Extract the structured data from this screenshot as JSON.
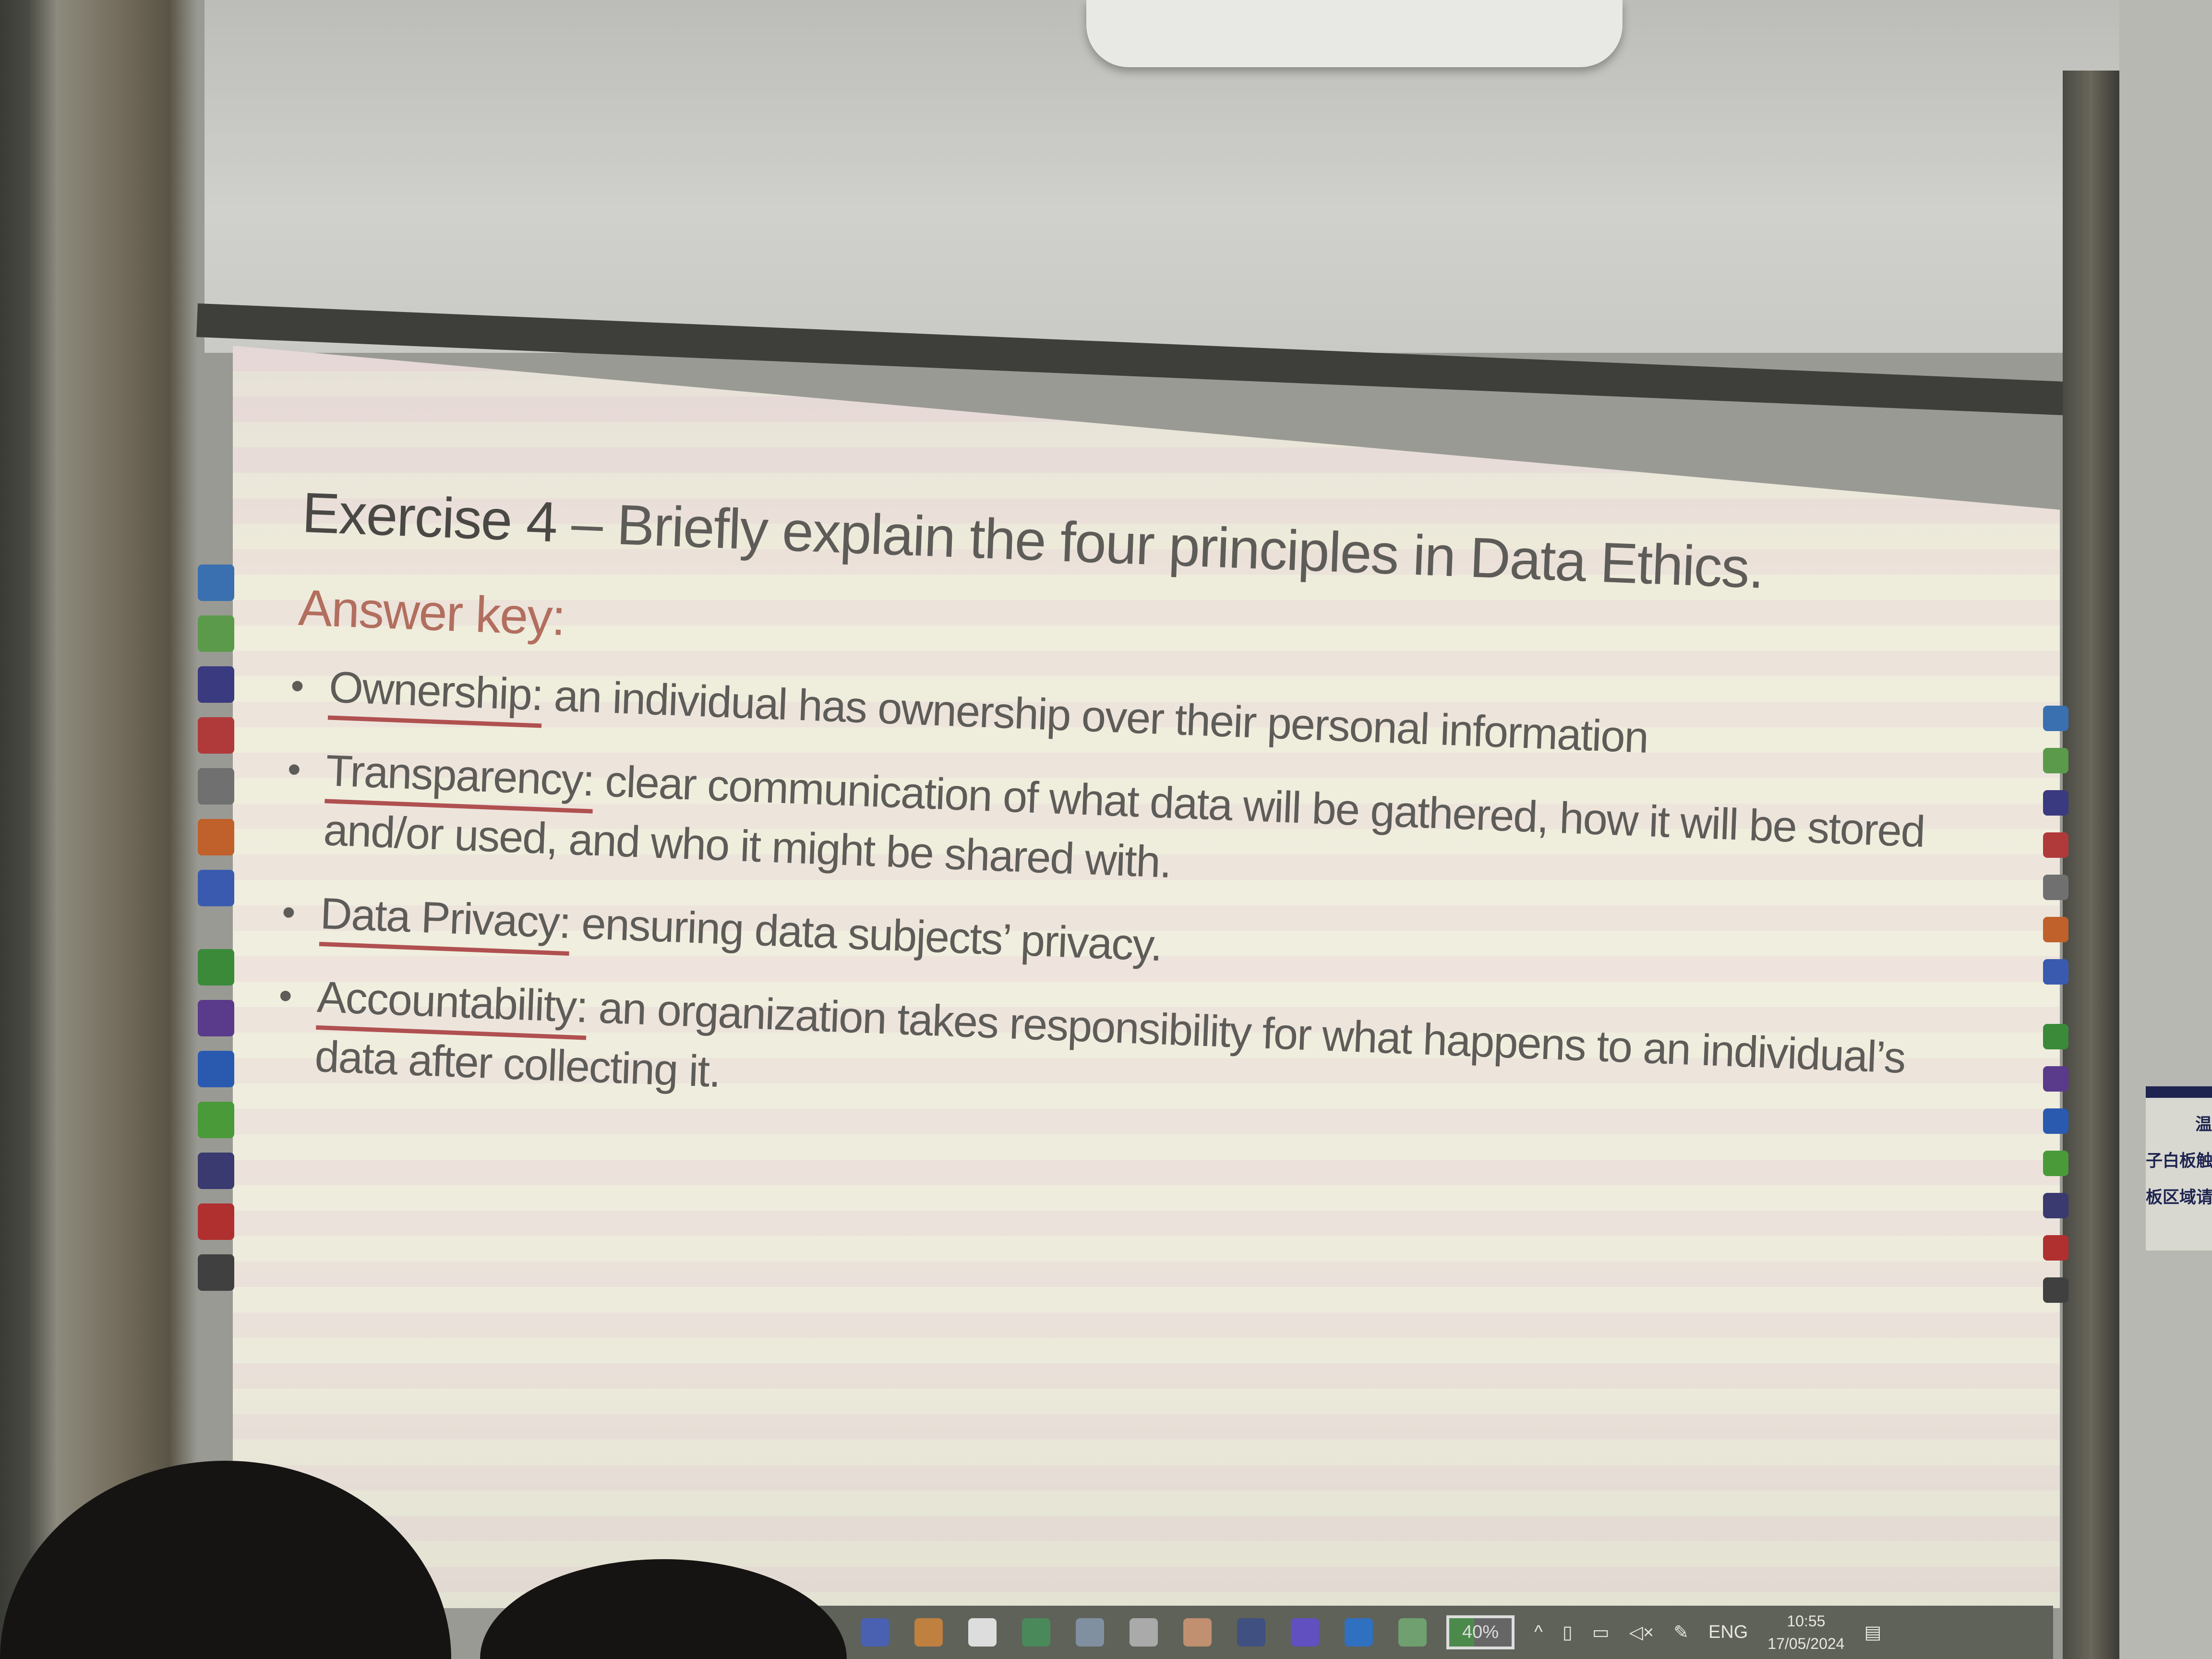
{
  "slide": {
    "title_prefix": "Exercise 4",
    "title_rest": " – Briefly explain the four principles in Data Ethics.",
    "answer_key_label": "Answer key:",
    "bullets": [
      {
        "term": "Ownership:",
        "text": " an individual has ownership over their personal information"
      },
      {
        "term": "Transparency:",
        "text": " clear communication of what data will be gathered, how it will be stored and/or used, and who it might be shared with."
      },
      {
        "term": "Data Privacy:",
        "text": " ensuring data subjects’ privacy."
      },
      {
        "term": "Accountability:",
        "text": " an organization takes responsibility for what happens to an individual’s data after collecting it."
      }
    ],
    "accent_color": "#b26e5e"
  },
  "taskbar": {
    "battery": "40%",
    "battery_level": 0.4,
    "language": "ENG",
    "time": "10:55",
    "date": "17/05/2024",
    "apps": [
      "teams-icon",
      "color-icon",
      "m-icon",
      "media-icon",
      "screen-icon",
      "pen-icon",
      "paint-icon",
      "shield-icon",
      "zoom-icon",
      "skype-icon",
      "grid-icon"
    ],
    "tray_icons": [
      "chevron-up-icon",
      "touch-icon",
      "display-icon",
      "mute-icon",
      "pen-icon",
      "notification-icon"
    ]
  },
  "sign": {
    "line1": "温",
    "line2": "子白板触控",
    "line3": "板区域请用"
  }
}
